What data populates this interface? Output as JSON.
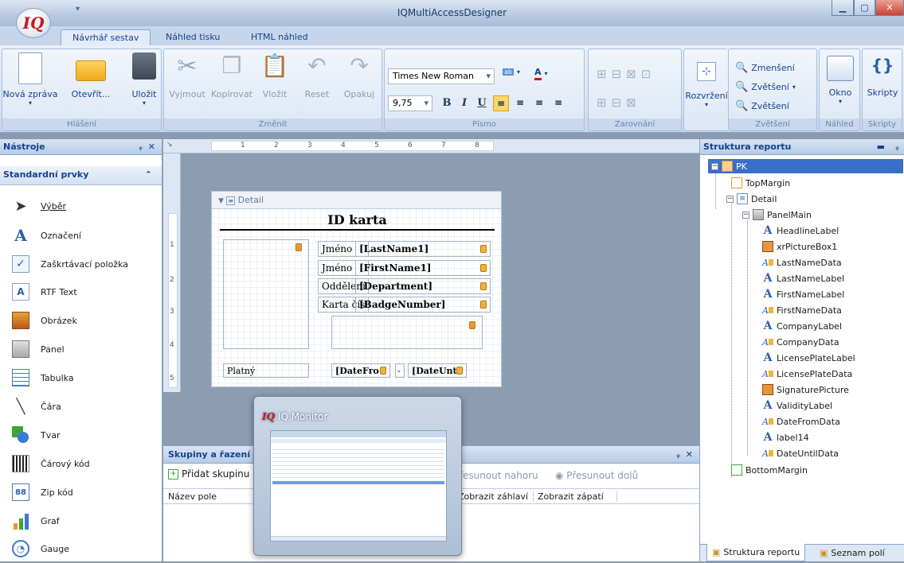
{
  "app": {
    "title": "IQMultiAccessDesigner",
    "logo": "IQ"
  },
  "tabs": [
    "Návrhář sestav",
    "Náhled tisku",
    "HTML náhled"
  ],
  "ribbon": {
    "groups": [
      "Hlášení",
      "Změnit",
      "Písmo",
      "Zarovnání",
      "Zvětšení",
      "Náhled",
      "Skripty"
    ],
    "report": [
      "Nová zpráva",
      "Otevřít...",
      "Uložit"
    ],
    "edit": [
      "Vyjmout",
      "Kopírovat",
      "Vložit",
      "Reset",
      "Opakuj"
    ],
    "font": {
      "name": "Times New Roman",
      "size": "9,75"
    },
    "layout": "Rozvržení",
    "zoom": [
      "Zmenšení",
      "Zvětšení",
      "Zvětšení"
    ],
    "window": "Okno",
    "scripts": "Skripty"
  },
  "tools": {
    "title": "Nástroje",
    "section": "Standardní prvky",
    "items": [
      "Výběr",
      "Označení",
      "Zaškrtávací položka",
      "RTF Text",
      "Obrázek",
      "Panel",
      "Tabulka",
      "Čára",
      "Tvar",
      "Čárový kód",
      "Zip kód",
      "Graf",
      "Gauge"
    ]
  },
  "ruler": [
    "1",
    "2",
    "3",
    "4",
    "5",
    "6",
    "7",
    "8"
  ],
  "ruler_left": [
    "1",
    "2",
    "3",
    "4",
    "5"
  ],
  "report": {
    "band": "Detail",
    "title": "ID karta",
    "rows": [
      {
        "label": "Jméno",
        "field": "[LastName1]"
      },
      {
        "label": "Jméno",
        "field": "[FirstName1]"
      },
      {
        "label": "Oddělení",
        "field": "[Department]"
      },
      {
        "label": "Karta čísl",
        "field": "[BadgeNumber]"
      }
    ],
    "valid": "Platný",
    "date_from": "[DateFro",
    "dash": "-",
    "date_until": "[DateUnti"
  },
  "groups": {
    "title": "Skupiny a řazení",
    "add": "Přidat skupinu",
    "up": "Přesunout nahoru",
    "down": "Přesunout dolů",
    "cols": [
      "Název pole",
      "Zobrazit záhlaví",
      "Zobrazit zápatí"
    ]
  },
  "monitor": {
    "title": "IQ Monitor"
  },
  "structure": {
    "title": "Struktura reportu",
    "root": "PK",
    "nodes": [
      "TopMargin",
      "Detail",
      "PanelMain"
    ],
    "children": [
      "HeadlineLabel",
      "xrPictureBox1",
      "LastNameData",
      "LastNameLabel",
      "FirstNameLabel",
      "FirstNameData",
      "CompanyLabel",
      "CompanyData",
      "LicensePlateLabel",
      "LicensePlateData",
      "SignaturePicture",
      "ValidityLabel",
      "DateFromData",
      "label14",
      "DateUntilData"
    ],
    "bottom": "BottomMargin",
    "tabs": [
      "Struktura reportu",
      "Seznam polí"
    ]
  },
  "colors": {
    "accent": "#15428b",
    "selection": "#3a6fc9"
  }
}
